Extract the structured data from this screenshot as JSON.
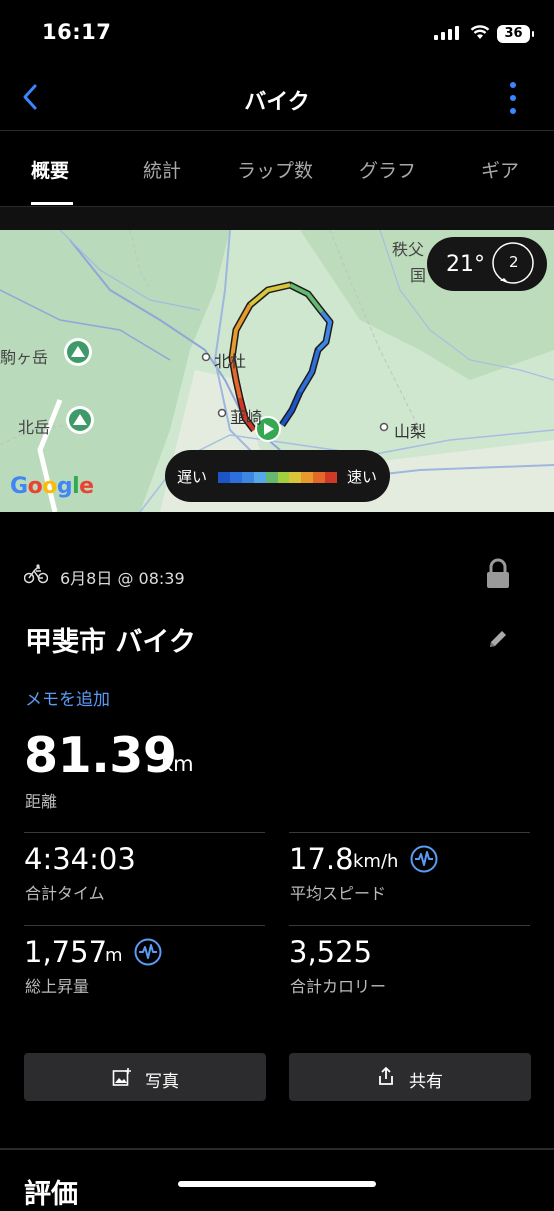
{
  "status_bar": {
    "time": "16:17",
    "battery": "36"
  },
  "header": {
    "title": "バイク"
  },
  "tabs": [
    {
      "label": "概要",
      "active": true
    },
    {
      "label": "統計"
    },
    {
      "label": "ラップ数"
    },
    {
      "label": "グラフ"
    },
    {
      "label": "ギア"
    }
  ],
  "map": {
    "temperature": "21°",
    "wind": "2",
    "legend": {
      "slow": "遅い",
      "fast": "速い",
      "colors": [
        "#1b55c7",
        "#2f6fdb",
        "#3f86e4",
        "#56a6ea",
        "#64b86f",
        "#a3cf3e",
        "#d8c53a",
        "#e89a2c",
        "#e3682a",
        "#cf3a28"
      ]
    },
    "places": {
      "chichibu": "秩父",
      "koku": "国",
      "komagatake": "駒ヶ岳",
      "hokuto": "北杜",
      "kitadake": "北岳",
      "nirasaki": "韮崎",
      "yamanashi": "山梨"
    },
    "logo": "Google"
  },
  "activity": {
    "date": "6月8日 @ 08:39",
    "name": "甲斐市 バイク",
    "add_note": "メモを追加",
    "distance": {
      "value": "81.39",
      "unit": "km",
      "label": "距離"
    },
    "stats": [
      {
        "value": "4:34:03",
        "unit": "",
        "label": "合計タイム"
      },
      {
        "value": "17.8",
        "unit": "km/h",
        "label": "平均スピード"
      },
      {
        "value": "1,757",
        "unit": "m",
        "label": "総上昇量"
      },
      {
        "value": "3,525",
        "unit": "",
        "label": "合計カロリー"
      }
    ]
  },
  "buttons": {
    "photo": "写真",
    "share": "共有"
  },
  "rating": {
    "title": "評価"
  },
  "colors": {
    "accent": "#3a86ff",
    "link": "#5b9bf5",
    "background": "#000000",
    "button": "#2c2c2e"
  }
}
